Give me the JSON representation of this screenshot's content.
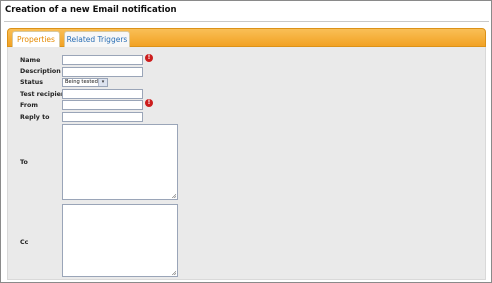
{
  "page": {
    "title": "Creation of a new Email notification"
  },
  "tabs": [
    {
      "label": "Properties",
      "active": true
    },
    {
      "label": "Related Triggers",
      "active": false
    }
  ],
  "form": {
    "name": {
      "label": "Name",
      "value": "",
      "required_error": true
    },
    "description": {
      "label": "Description",
      "value": ""
    },
    "status": {
      "label": "Status",
      "selected": "Being tested"
    },
    "test_recipient": {
      "label": "Test recipient",
      "value": ""
    },
    "from": {
      "label": "From",
      "value": "",
      "required_error": true
    },
    "reply_to": {
      "label": "Reply to",
      "value": ""
    },
    "to": {
      "label": "To",
      "value": ""
    },
    "cc": {
      "label": "Cc",
      "value": ""
    }
  },
  "icons": {
    "error": "exclamation-circle-icon",
    "dropdown": "chevron-down-icon",
    "resize": "resize-grip-icon"
  },
  "colors": {
    "tab_bar": "#f2a224",
    "active_tab_text": "#e58a00",
    "inactive_tab_text": "#2a6fb5",
    "panel_bg": "#eaeaea",
    "error": "#cc1d1d"
  }
}
